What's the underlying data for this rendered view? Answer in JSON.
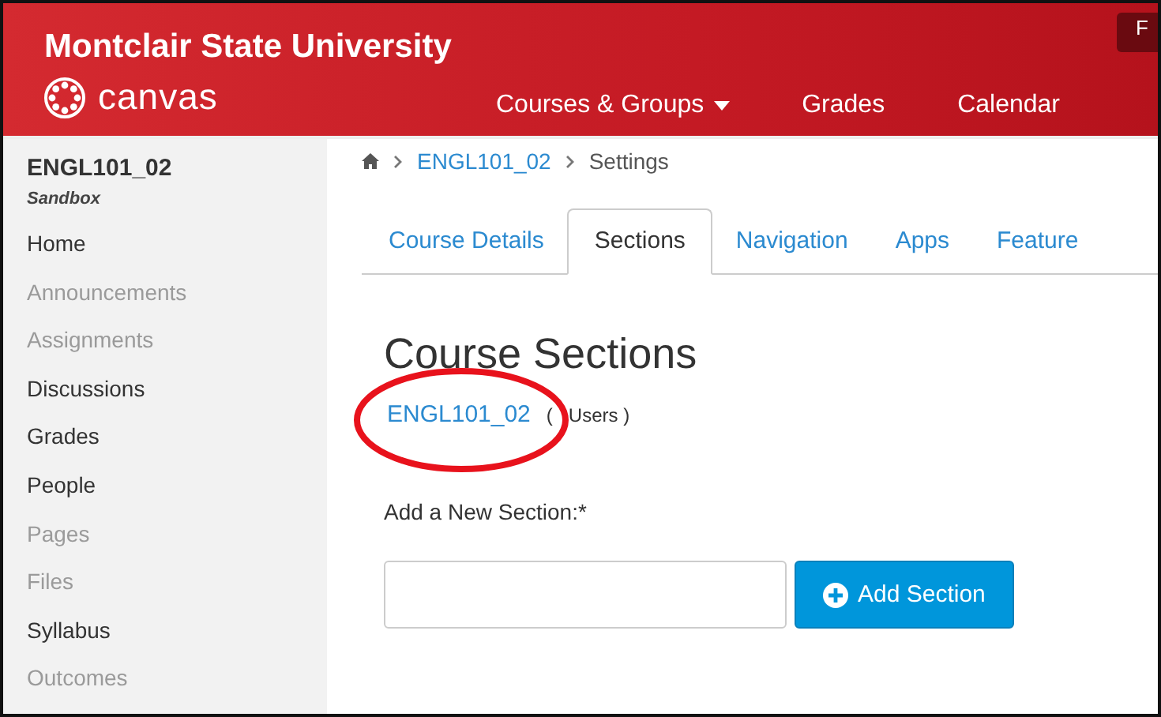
{
  "header": {
    "institution": "Montclair State University",
    "logo_text": "canvas",
    "nav": [
      {
        "label": "Courses & Groups",
        "dropdown": true
      },
      {
        "label": "Grades",
        "dropdown": false
      },
      {
        "label": "Calendar",
        "dropdown": false
      }
    ],
    "corner_button": "F"
  },
  "sidebar": {
    "course": "ENGL101_02",
    "term": "Sandbox",
    "items": [
      {
        "label": "Home",
        "disabled": false
      },
      {
        "label": "Announcements",
        "disabled": true
      },
      {
        "label": "Assignments",
        "disabled": true
      },
      {
        "label": "Discussions",
        "disabled": false
      },
      {
        "label": "Grades",
        "disabled": false
      },
      {
        "label": "People",
        "disabled": false
      },
      {
        "label": "Pages",
        "disabled": true
      },
      {
        "label": "Files",
        "disabled": true
      },
      {
        "label": "Syllabus",
        "disabled": false
      },
      {
        "label": "Outcomes",
        "disabled": true
      }
    ]
  },
  "breadcrumb": [
    {
      "label": "ENGL101_02",
      "link": true
    },
    {
      "label": "Settings",
      "link": false
    }
  ],
  "tabs": [
    {
      "label": "Course Details",
      "selected": false
    },
    {
      "label": "Sections",
      "selected": true
    },
    {
      "label": "Navigation",
      "selected": false
    },
    {
      "label": "Apps",
      "selected": false
    },
    {
      "label": "Feature",
      "selected": false
    }
  ],
  "heading": "Course Sections",
  "sections": [
    {
      "name": "ENGL101_02",
      "users_open": "(",
      "users_rest": "Users )"
    }
  ],
  "new_section": {
    "label": "Add a New Section:*",
    "button": "Add Section"
  }
}
